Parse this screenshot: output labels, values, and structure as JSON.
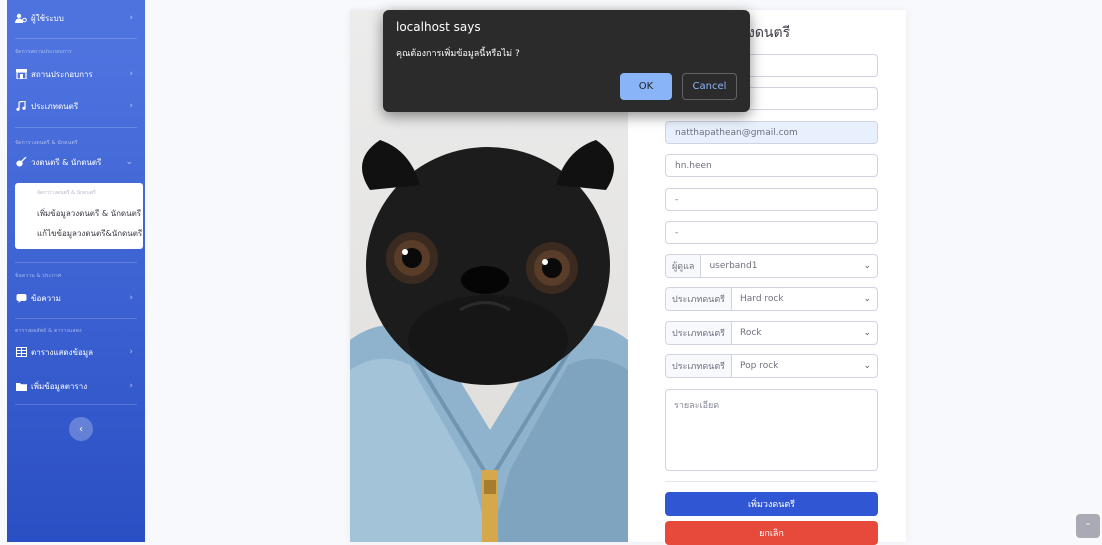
{
  "sidebar": {
    "users": "ผู้ใช้ระบบ",
    "heading_venues": "จัดการสถานประกอบการ",
    "venues": "สถานประกอบการ",
    "music_types": "ประเภทดนตรี",
    "heading_bands": "จัดการวงดนตรี & นักดนตรี",
    "bands": "วงดนตรี & นักดนตรี",
    "collapse": {
      "header": "จัดการวงดนตรี & นักดนตรี",
      "add": "เพิ่มข้อมูลวงดนตรี & นักดนตรี",
      "edit": "แก้ไขข้อมูลวงดนตรี&นักดนตรี"
    },
    "heading_messages": "ข้อความ & ประกาศ",
    "messages": "ข้อความ",
    "heading_tables": "ตารางผลลัพธ์ & ตารางแสดง",
    "table_view": "ตารางแสดงข้อมูล",
    "table_add": "เพิ่มข้อมูลตาราง",
    "toggle": "‹"
  },
  "form": {
    "title_fragment": "งดนตรี",
    "email": "natthapathean@gmail.com",
    "username": "hn.heen",
    "field5": "-",
    "field6": "-",
    "manager_label": "ผู้ดูแล",
    "manager_value": "userband1",
    "genre_label": "ประเภทดนตรี",
    "genre1": "Hard rock",
    "genre2": "Rock",
    "genre3": "Pop rock",
    "details_placeholder": "รายละเอียด",
    "submit": "เพิ่มวงดนตรี",
    "cancel": "ยกเลิก"
  },
  "dialog": {
    "title": "localhost says",
    "message": "คุณต้องการเพิ่มข้อมูลนี้หรือไม่ ?",
    "ok": "OK",
    "cancel": "Cancel"
  },
  "colors": {
    "sidebar": "#4e73df",
    "primary_button": "#3056d3",
    "danger_button": "#e74a3b",
    "dialog_ok": "#8ab4f8"
  },
  "icons": {
    "users": "user-cog-icon",
    "venues": "store-icon",
    "music": "music-note-icon",
    "bands": "guitar-icon",
    "messages": "message-icon",
    "table": "table-icon",
    "folder": "folder-icon",
    "chevron": "chevron-right-icon",
    "dropdown": "chevron-down-icon",
    "scroll_top": "chevron-up-icon"
  }
}
